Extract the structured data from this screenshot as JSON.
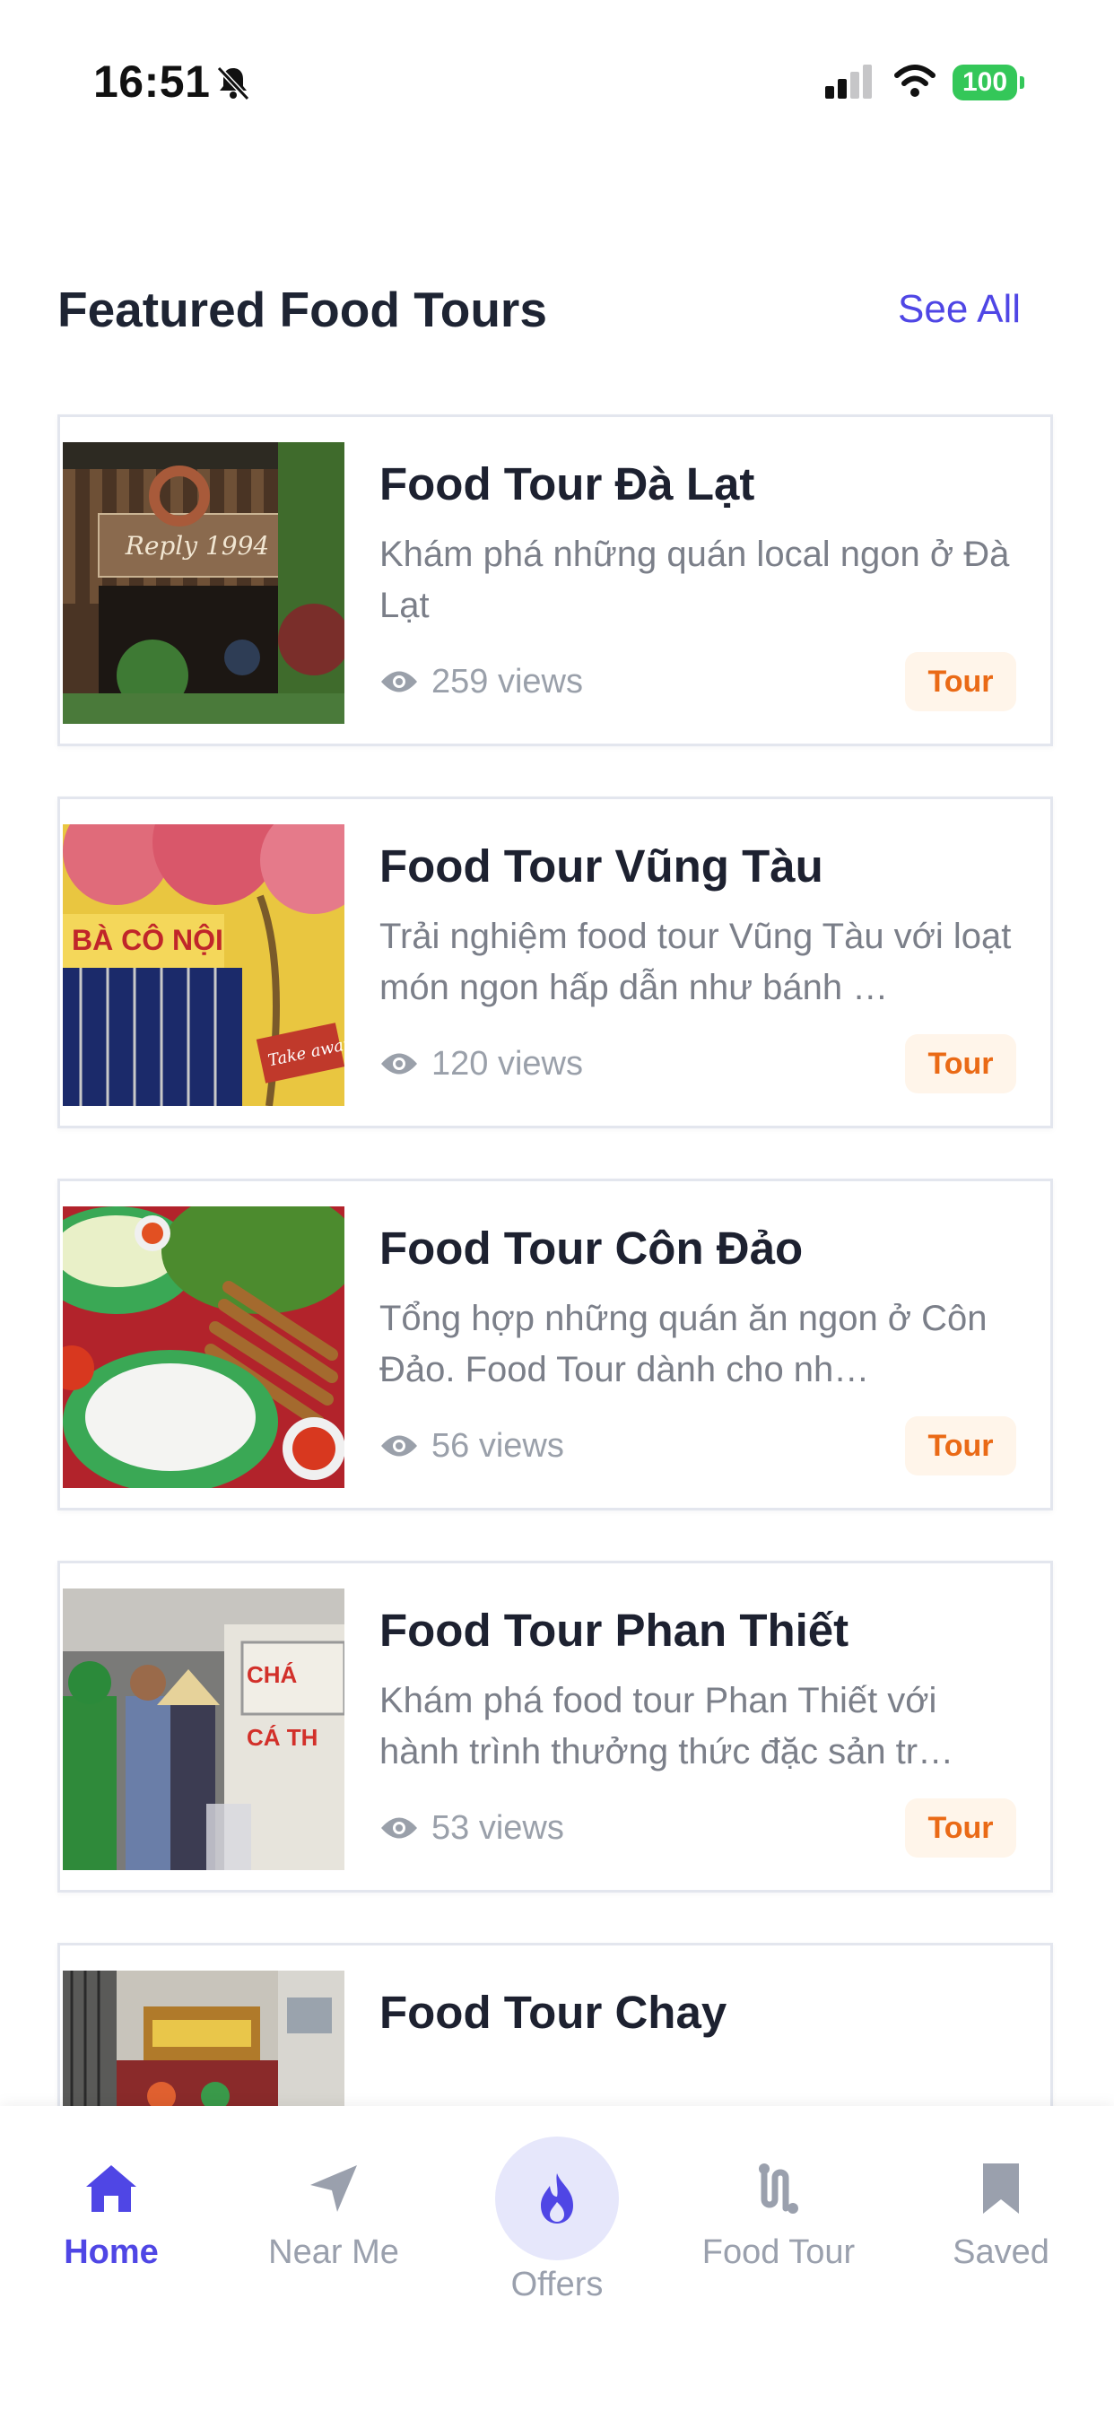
{
  "status_bar": {
    "time": "16:51",
    "battery": "100",
    "battery_color": "#34c759"
  },
  "section": {
    "title": "Featured Food Tours",
    "see_all": "See All"
  },
  "colors": {
    "accent": "#4f46e5",
    "badge_text": "#ea6a16",
    "badge_bg": "#fff5ea"
  },
  "tours": [
    {
      "title": "Food Tour Đà Lạt",
      "description": "Khám phá những quán local ngon ở Đà Lạt",
      "views": "259 views",
      "badge": "Tour",
      "image": "wooden-cafe-reply-1994"
    },
    {
      "title": "Food Tour Vũng Tàu",
      "description": "Trải nghiệm food tour Vũng Tàu với loạt món ngon hấp dẫn như bánh …",
      "views": "120 views",
      "badge": "Tour",
      "image": "ba-con-noi-storefront"
    },
    {
      "title": "Food Tour Côn Đảo",
      "description": "Tổng hợp những quán ăn ngon ở Côn Đảo. Food Tour dành cho nh…",
      "views": "56 views",
      "badge": "Tour",
      "image": "grilled-skewers-rice-noodles"
    },
    {
      "title": "Food Tour Phan Thiết",
      "description": "Khám phá food tour Phan Thiết với hành trình thưởng thức đặc sản tr…",
      "views": "53 views",
      "badge": "Tour",
      "image": "street-food-stall"
    },
    {
      "title": "Food Tour Chay",
      "description": "",
      "views": "",
      "badge": "",
      "image": "vegetarian-restaurant-facade"
    }
  ],
  "bottom_nav": {
    "items": [
      {
        "label": "Home",
        "icon": "home-icon",
        "active": true
      },
      {
        "label": "Near Me",
        "icon": "navigation-arrow-icon",
        "active": false
      },
      {
        "label": "Offers",
        "icon": "flame-icon",
        "active": false
      },
      {
        "label": "Food Tour",
        "icon": "route-icon",
        "active": false
      },
      {
        "label": "Saved",
        "icon": "bookmark-icon",
        "active": false
      }
    ]
  }
}
